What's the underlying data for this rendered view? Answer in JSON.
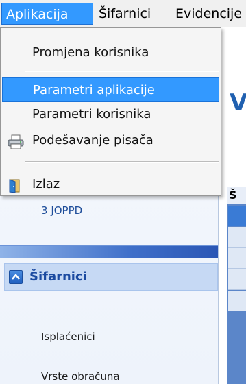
{
  "menubar": {
    "items": [
      {
        "label": "Aplikacija"
      },
      {
        "label": "Šifarnici"
      },
      {
        "label": "Evidencije"
      }
    ]
  },
  "dropdown": {
    "items": [
      {
        "label": "Promjena korisnika",
        "icon": ""
      },
      {
        "label": "Parametri aplikacije",
        "icon": "",
        "highlighted": true
      },
      {
        "label": "Parametri korisnika",
        "icon": ""
      },
      {
        "label": "Podešavanje pisača",
        "icon": "printer-icon"
      },
      {
        "label": "Izlaz",
        "icon": "exit-door-icon"
      }
    ]
  },
  "nav": {
    "joppd_mnemonic": "3",
    "joppd_rest": " JOPPD",
    "section_title": "Šifarnici",
    "links": [
      "Isplaćenici",
      "Vrste obračuna"
    ]
  },
  "workspace": {
    "title_fragment": "V",
    "grid_header_fragment": "Š"
  },
  "colors": {
    "highlight": "#3399ff",
    "section_bg": "#c6d9f4",
    "section_title": "#1b4aa0",
    "nav_bg": "#f5f8fd"
  }
}
